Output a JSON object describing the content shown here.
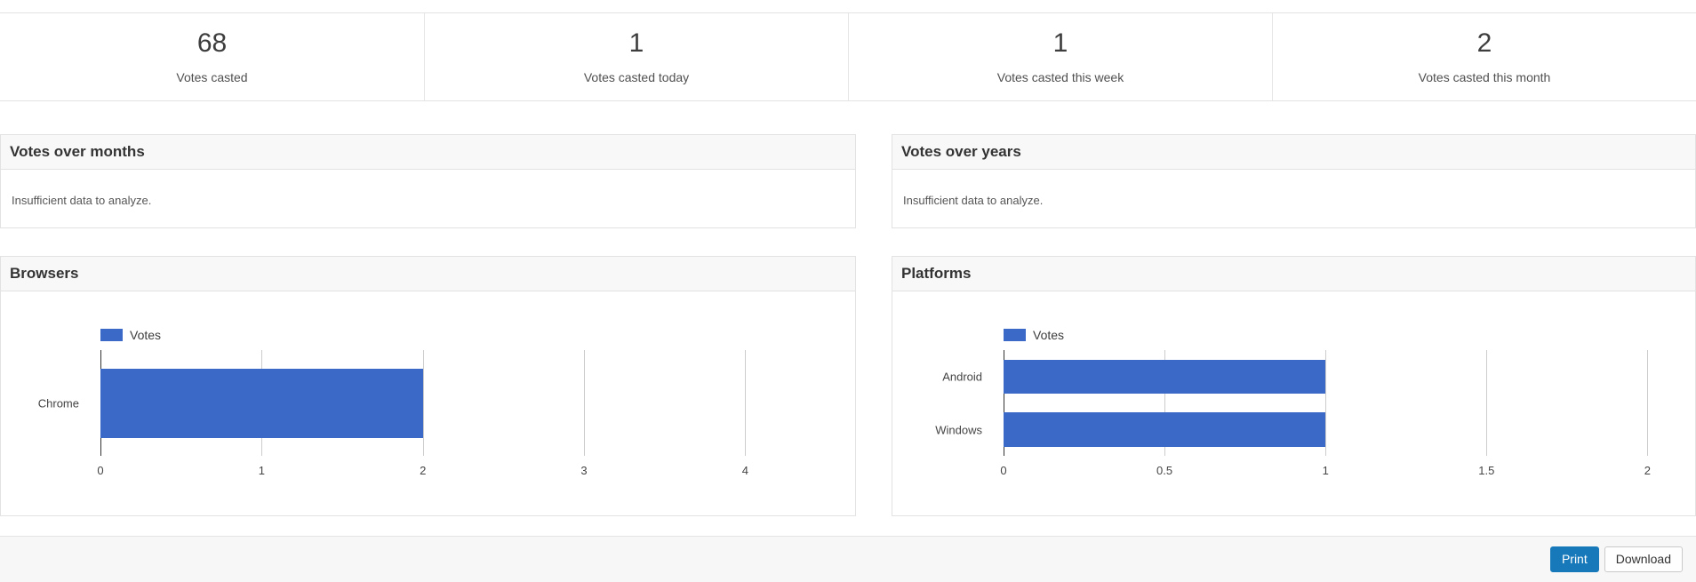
{
  "stats": [
    {
      "value": "68",
      "label": "Votes casted"
    },
    {
      "value": "1",
      "label": "Votes casted today"
    },
    {
      "value": "1",
      "label": "Votes casted this week"
    },
    {
      "value": "2",
      "label": "Votes casted this month"
    }
  ],
  "panels": {
    "votes_over_months": {
      "title": "Votes over months",
      "message": "Insufficient data to analyze."
    },
    "votes_over_years": {
      "title": "Votes over years",
      "message": "Insufficient data to analyze."
    }
  },
  "chart_data": [
    {
      "type": "bar",
      "orientation": "horizontal",
      "title": "Browsers",
      "legend": "Votes",
      "legend_position": "top",
      "categories": [
        "Chrome"
      ],
      "values": [
        2
      ],
      "xticks": [
        0,
        1,
        2,
        3,
        4
      ],
      "xlim": [
        0,
        4.29
      ],
      "grid": true,
      "color": "#3a69c8"
    },
    {
      "type": "bar",
      "orientation": "horizontal",
      "title": "Platforms",
      "legend": "Votes",
      "legend_position": "top",
      "categories": [
        "Android",
        "Windows"
      ],
      "values": [
        1,
        1
      ],
      "xticks": [
        0,
        0.5,
        1,
        1.5,
        2
      ],
      "xlim": [
        0,
        2.09
      ],
      "grid": true,
      "color": "#3a69c8"
    }
  ],
  "footer": {
    "print_label": "Print",
    "download_label": "Download"
  },
  "colors": {
    "bar_blue": "#3a69c8",
    "print_button": "#1779ba",
    "panel_header_bg": "#f8f8f8",
    "gridline": "#cccccc"
  }
}
